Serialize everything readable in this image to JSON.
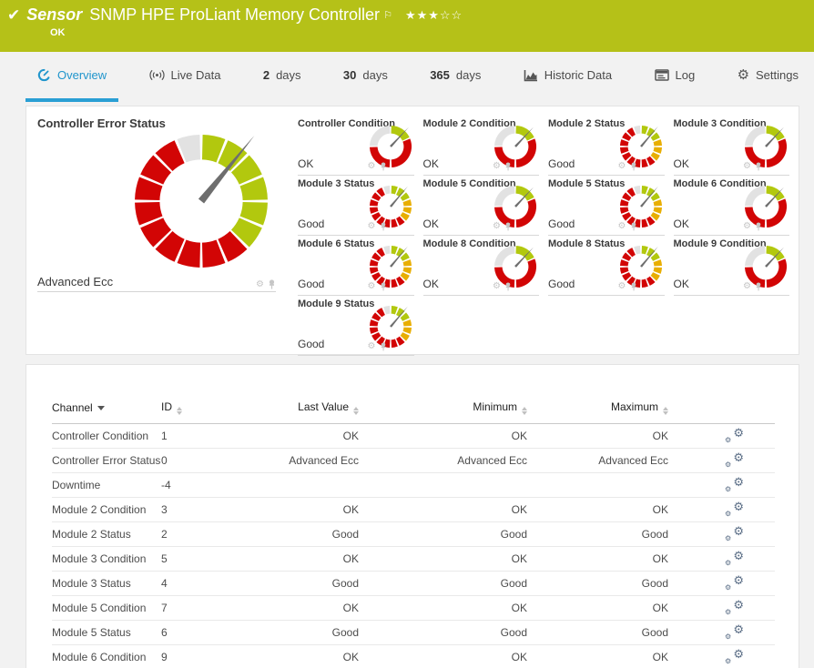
{
  "header": {
    "type_label": "Sensor",
    "title": "SNMP HPE ProLiant Memory Controller",
    "status": "OK",
    "priority": {
      "filled": 3,
      "total": 5
    }
  },
  "tabs": [
    {
      "name": "overview",
      "icon": "gauge",
      "label": "Overview",
      "active": true
    },
    {
      "name": "live-data",
      "icon": "live",
      "label": "Live Data"
    },
    {
      "name": "2-days",
      "bold": "2",
      "label": "days"
    },
    {
      "name": "30-days",
      "bold": "30",
      "label": "days"
    },
    {
      "name": "365-days",
      "bold": "365",
      "label": "days"
    },
    {
      "name": "historic-data",
      "icon": "chart",
      "label": "Historic Data"
    },
    {
      "name": "log",
      "icon": "log",
      "label": "Log"
    },
    {
      "name": "settings",
      "icon": "gear",
      "label": "Settings"
    }
  ],
  "colors": {
    "topbar_green": "#b5c118",
    "tab_active_blue": "#2095cc",
    "gauge_green": "#b2c80e",
    "gauge_red": "#d20505",
    "gauge_yellow": "#e8ae02",
    "gauge_gray": "#e2e2e2",
    "needle": "#6e6e6e"
  },
  "gauge_kinds": {
    "error_status": {
      "bands": [
        {
          "color": "gauge_green",
          "count": 6
        },
        {
          "color": "gauge_red",
          "count": 9
        },
        {
          "color": "gauge_gray",
          "count": 1
        }
      ],
      "seg_angle": 22.5,
      "gap": 2.5,
      "needle_angle": 39
    },
    "condition": {
      "segments": [
        {
          "color": "gauge_green",
          "from": 2,
          "to": 64
        },
        {
          "color": "gauge_red",
          "from": 68,
          "to": 177
        },
        {
          "color": "gauge_red",
          "from": 183,
          "to": 268
        },
        {
          "color": "gauge_gray",
          "from": 272,
          "to": 358
        }
      ],
      "needle_angle": 43
    },
    "status": {
      "bands": [
        {
          "color": "gauge_green",
          "count": 3
        },
        {
          "color": "gauge_yellow",
          "count": 3
        },
        {
          "color": "gauge_red",
          "count": 9
        },
        {
          "color": "gauge_gray",
          "count": 1
        }
      ],
      "seg_angle": 22.5,
      "gap": 5,
      "needle_angle": 40
    }
  },
  "overview": {
    "featured": {
      "title": "Controller Error Status",
      "value": "Advanced Ecc",
      "kind": "error_status"
    },
    "gauges": [
      {
        "title": "Controller Condition",
        "value": "OK",
        "kind": "condition"
      },
      {
        "title": "Module 2 Condition",
        "value": "OK",
        "kind": "condition"
      },
      {
        "title": "Module 2 Status",
        "value": "Good",
        "kind": "status"
      },
      {
        "title": "Module 3 Condition",
        "value": "OK",
        "kind": "condition"
      },
      {
        "title": "Module 3 Status",
        "value": "Good",
        "kind": "status"
      },
      {
        "title": "Module 5 Condition",
        "value": "OK",
        "kind": "condition"
      },
      {
        "title": "Module 5 Status",
        "value": "Good",
        "kind": "status"
      },
      {
        "title": "Module 6 Condition",
        "value": "OK",
        "kind": "condition"
      },
      {
        "title": "Module 6 Status",
        "value": "Good",
        "kind": "status"
      },
      {
        "title": "Module 8 Condition",
        "value": "OK",
        "kind": "condition"
      },
      {
        "title": "Module 8 Status",
        "value": "Good",
        "kind": "status"
      },
      {
        "title": "Module 9 Condition",
        "value": "OK",
        "kind": "condition"
      },
      {
        "title": "Module 9 Status",
        "value": "Good",
        "kind": "status"
      }
    ]
  },
  "table": {
    "columns": [
      {
        "label": "Channel",
        "sort": "active-desc",
        "align": "left"
      },
      {
        "label": "ID",
        "sort": "both",
        "align": "left"
      },
      {
        "label": "Last Value",
        "sort": "both",
        "align": "right"
      },
      {
        "label": "Minimum",
        "sort": "both",
        "align": "right"
      },
      {
        "label": "Maximum",
        "sort": "both",
        "align": "right"
      }
    ],
    "rows": [
      [
        "Controller Condition",
        "1",
        "OK",
        "OK",
        "OK"
      ],
      [
        "Controller Error Status",
        "0",
        "Advanced Ecc",
        "Advanced Ecc",
        "Advanced Ecc"
      ],
      [
        "Downtime",
        "-4",
        "",
        "",
        ""
      ],
      [
        "Module 2 Condition",
        "3",
        "OK",
        "OK",
        "OK"
      ],
      [
        "Module 2 Status",
        "2",
        "Good",
        "Good",
        "Good"
      ],
      [
        "Module 3 Condition",
        "5",
        "OK",
        "OK",
        "OK"
      ],
      [
        "Module 3 Status",
        "4",
        "Good",
        "Good",
        "Good"
      ],
      [
        "Module 5 Condition",
        "7",
        "OK",
        "OK",
        "OK"
      ],
      [
        "Module 5 Status",
        "6",
        "Good",
        "Good",
        "Good"
      ],
      [
        "Module 6 Condition",
        "9",
        "OK",
        "OK",
        "OK"
      ]
    ]
  }
}
